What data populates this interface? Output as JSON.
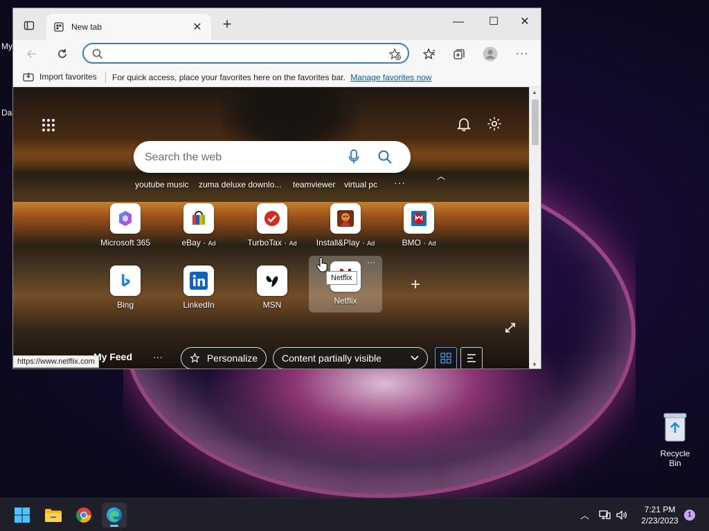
{
  "desktop": {
    "edge_labels": [
      "My",
      "Da"
    ],
    "recycle_bin_label": "Recycle Bin"
  },
  "browser": {
    "tab_title": "New tab",
    "address_value": "",
    "favbar": {
      "import_label": "Import favorites",
      "message": "For quick access, place your favorites here on the favorites bar.",
      "manage_link": "Manage favorites now"
    }
  },
  "ntp": {
    "search_placeholder": "Search the web",
    "suggestions": [
      "youtube music",
      "zuma deluxe downlo...",
      "teamviewer",
      "virtual pc"
    ],
    "quick_links": [
      {
        "label": "Microsoft 365",
        "ad": ""
      },
      {
        "label": "eBay",
        "ad": "Ad"
      },
      {
        "label": "TurboTax",
        "ad": "Ad"
      },
      {
        "label": "Install&Play",
        "ad": "Ad"
      },
      {
        "label": "BMO",
        "ad": "Ad"
      },
      {
        "label": "Bing",
        "ad": ""
      },
      {
        "label": "LinkedIn",
        "ad": ""
      },
      {
        "label": "MSN",
        "ad": ""
      },
      {
        "label": "Netflix",
        "ad": ""
      }
    ],
    "tooltip": "Netflix",
    "feed": {
      "my_feed": "My Feed",
      "personalize": "Personalize",
      "content_select": "Content partially visible"
    },
    "status_url": "https://www.netflix.com"
  },
  "taskbar": {
    "time": "7:21 PM",
    "date": "2/23/2023",
    "notifications": "1"
  },
  "colors": {
    "accent": "#2f7bd6",
    "link": "#0a58b3"
  }
}
